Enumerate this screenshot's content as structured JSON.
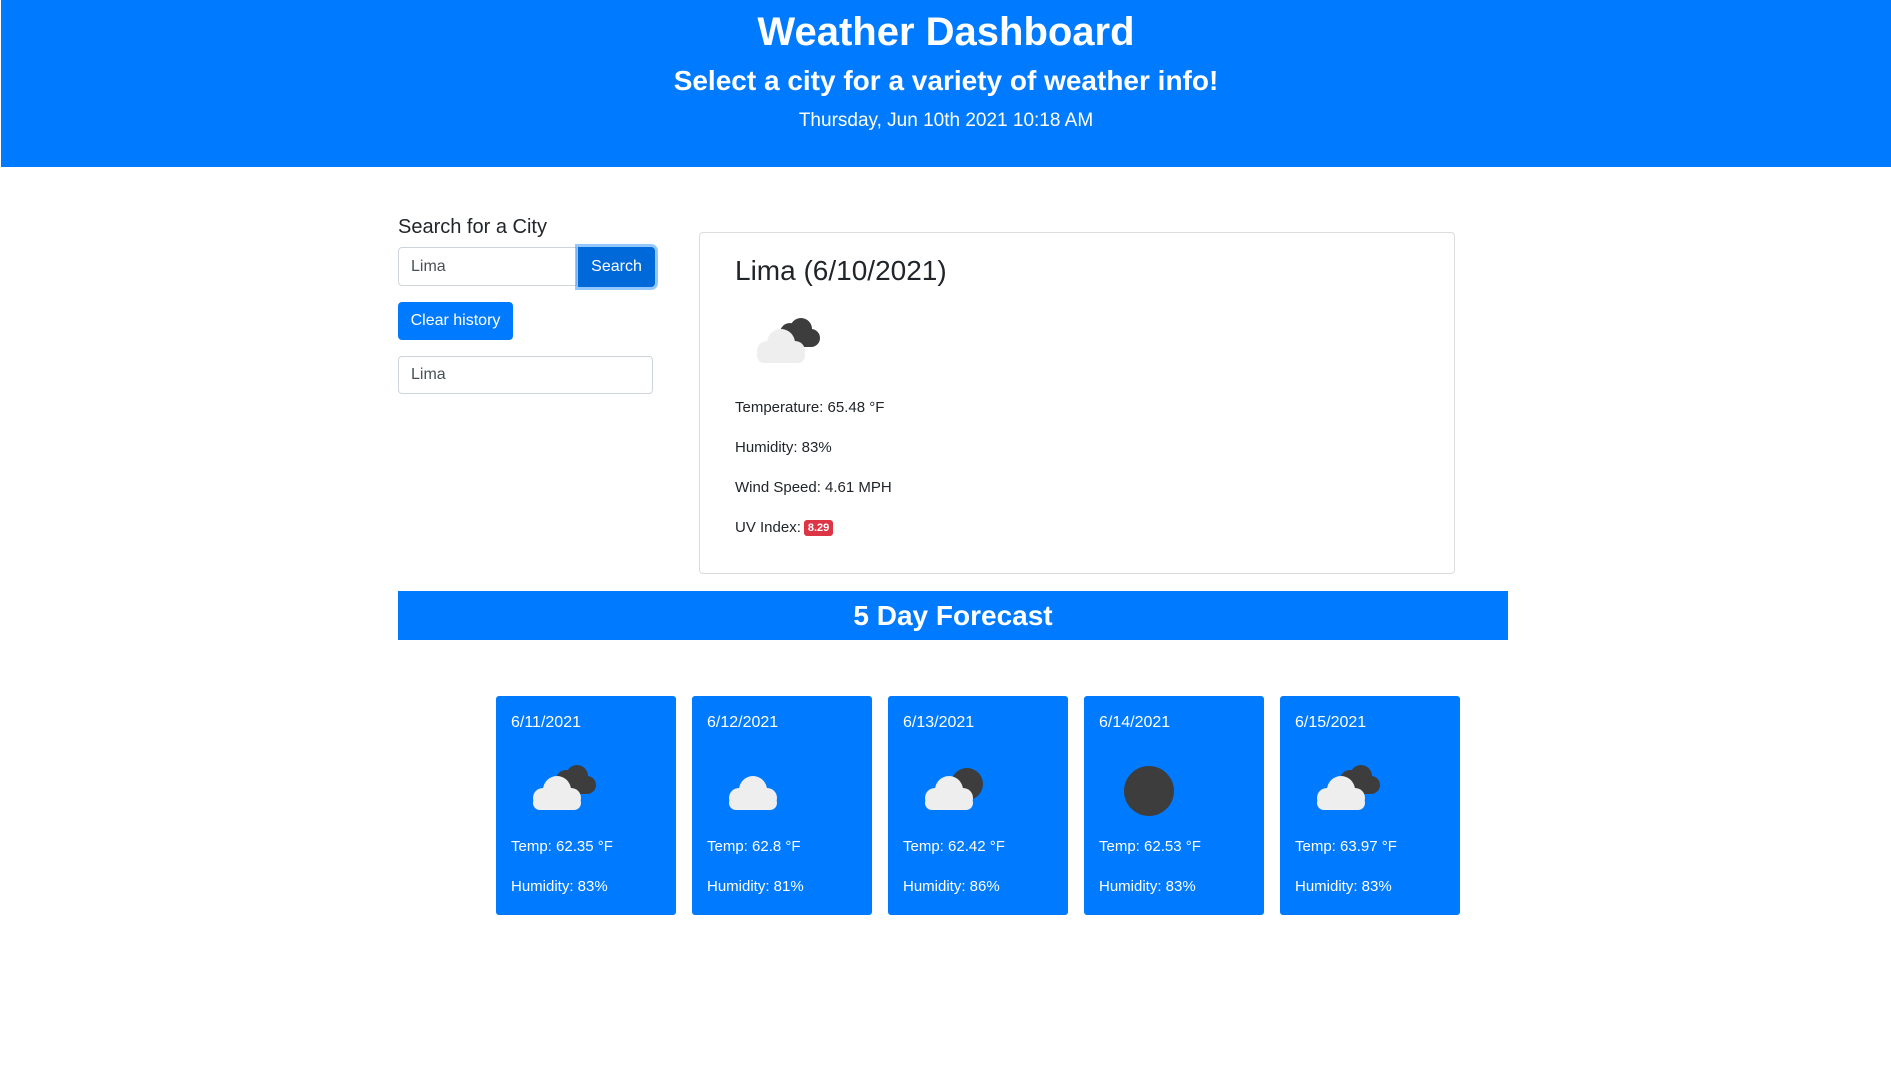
{
  "header": {
    "title": "Weather Dashboard",
    "subtitle": "Select a city for a variety of weather info!",
    "datetime": "Thursday, Jun 10th 2021 10:18 AM"
  },
  "search": {
    "label": "Search for a City",
    "input_value": "Lima",
    "button_label": "Search",
    "clear_label": "Clear history",
    "history": [
      "Lima"
    ]
  },
  "current": {
    "title": "Lima (6/10/2021)",
    "icon": "broken-clouds-icon",
    "temperature": "Temperature: 65.48 °F",
    "humidity": "Humidity: 83%",
    "wind": "Wind Speed: 4.61 MPH",
    "uv_label": "UV Index:",
    "uv_value": "8.29"
  },
  "forecast": {
    "banner": "5 Day Forecast",
    "days": [
      {
        "date": "6/11/2021",
        "icon": "broken-clouds-icon",
        "temp": "Temp: 62.35 °F",
        "humidity": "Humidity: 83%"
      },
      {
        "date": "6/12/2021",
        "icon": "cloud-icon",
        "temp": "Temp: 62.8 °F",
        "humidity": "Humidity: 81%"
      },
      {
        "date": "6/13/2021",
        "icon": "partly-cloudy-icon",
        "temp": "Temp: 62.42 °F",
        "humidity": "Humidity: 86%"
      },
      {
        "date": "6/14/2021",
        "icon": "clear-night-icon",
        "temp": "Temp: 62.53 °F",
        "humidity": "Humidity: 83%"
      },
      {
        "date": "6/15/2021",
        "icon": "broken-clouds-icon",
        "temp": "Temp: 63.97 °F",
        "humidity": "Humidity: 83%"
      }
    ]
  },
  "colors": {
    "primary": "#007bff",
    "uv_badge": "#dc3545"
  }
}
